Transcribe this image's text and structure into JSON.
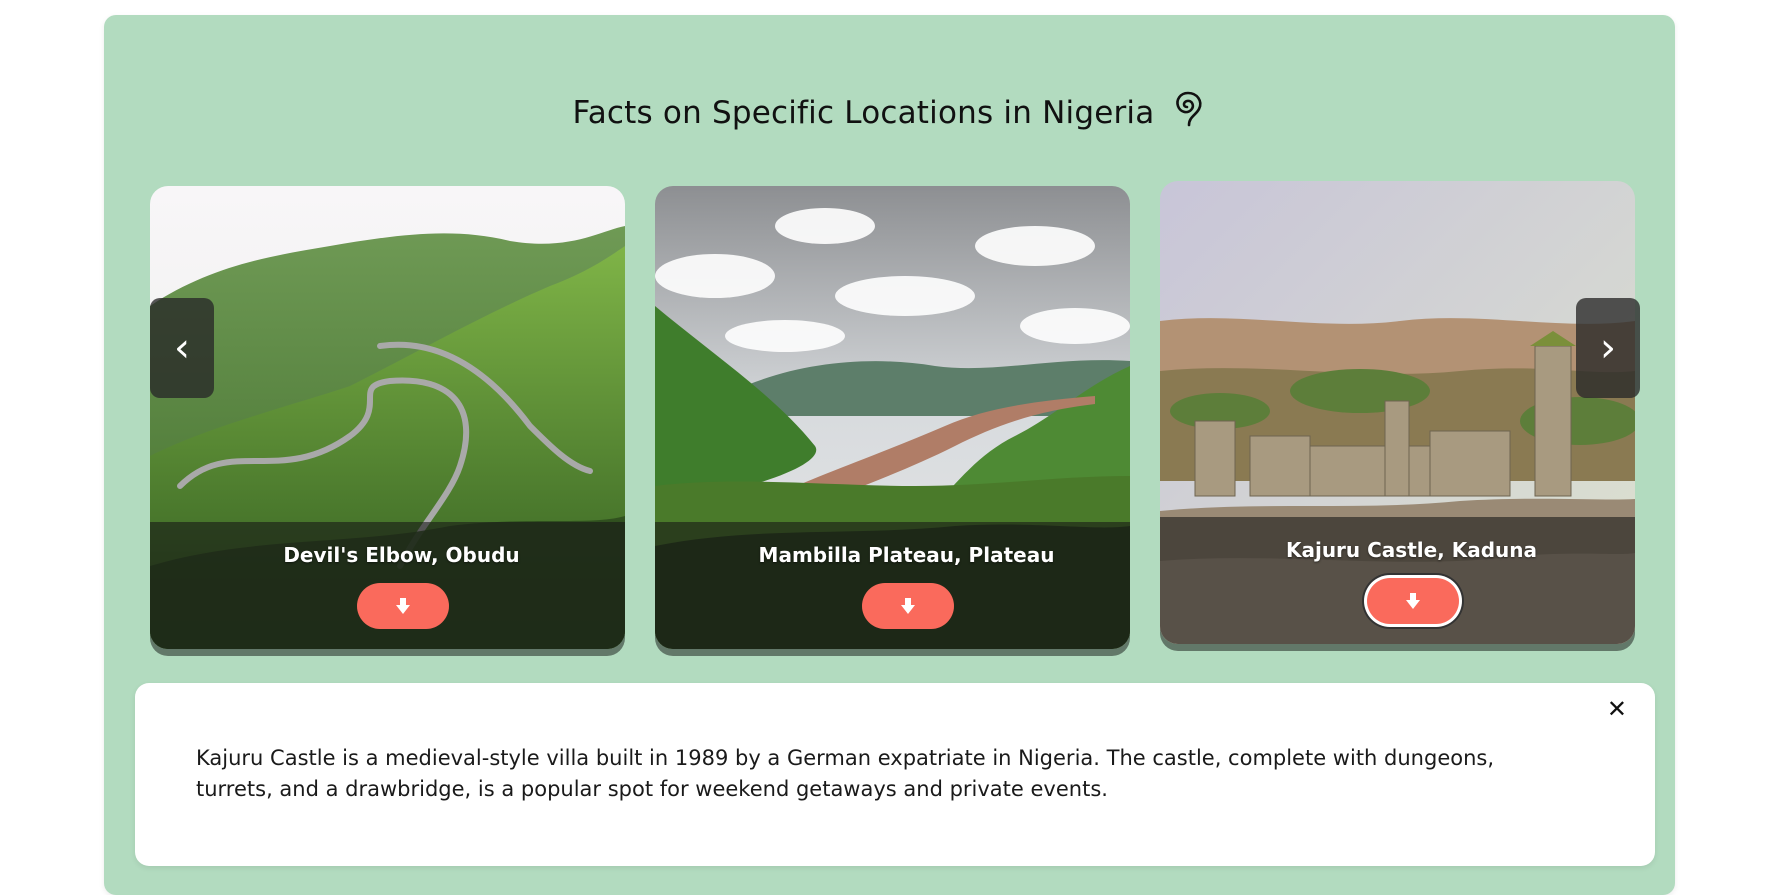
{
  "page": {
    "title": "Facts on Specific Locations in Nigeria",
    "title_icon": "swirl-icon"
  },
  "cards": [
    {
      "caption": "Devil's Elbow, Obudu",
      "button_icon": "arrow-down-icon"
    },
    {
      "caption": "Mambilla Plateau, Plateau",
      "button_icon": "arrow-down-icon"
    },
    {
      "caption": "Kajuru Castle, Kaduna",
      "button_icon": "arrow-down-icon"
    }
  ],
  "carousel": {
    "prev_label": "‹",
    "next_label": "›"
  },
  "fact": {
    "text": "Kajuru Castle is a medieval-style villa built in 1989 by a German expatriate in Nigeria. The castle, complete with dungeons, turrets, and a drawbridge, is a popular spot for weekend getaways and private events.",
    "close_label": "✕"
  },
  "colors": {
    "panel_bg": "#b2dbbf",
    "button": "#fa6a5c"
  }
}
